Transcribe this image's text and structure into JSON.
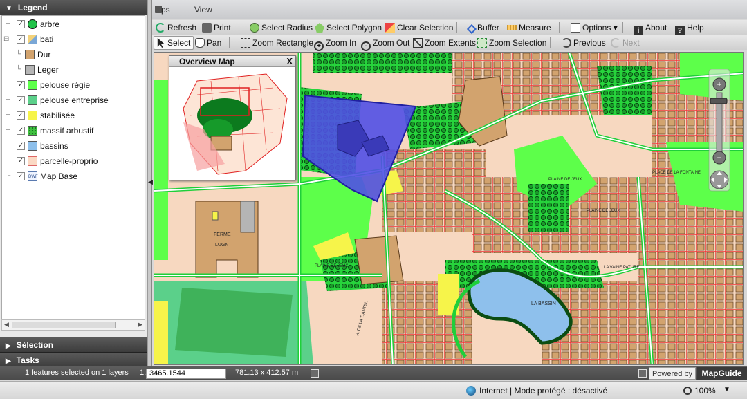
{
  "menubar": {
    "item1": "ps",
    "item2": "View"
  },
  "toolbar1": {
    "refresh": "Refresh",
    "print": "Print",
    "select_radius": "Select Radius",
    "select_polygon": "Select Polygon",
    "clear_selection": "Clear Selection",
    "buffer": "Buffer",
    "measure": "Measure",
    "options": "Options",
    "about": "About",
    "help": "Help"
  },
  "toolbar2": {
    "select": "Select",
    "pan": "Pan",
    "zoom_rectangle": "Zoom Rectangle",
    "zoom_in": "Zoom In",
    "zoom_out": "Zoom Out",
    "zoom_extents": "Zoom Extents",
    "zoom_selection": "Zoom Selection",
    "previous": "Previous",
    "next": "Next"
  },
  "legend": {
    "title": "Legend",
    "items": [
      {
        "label": "arbre",
        "color": "#22c34a",
        "shape": "circle",
        "checked": true
      },
      {
        "label": "bati",
        "color": "#7aa7d6",
        "shape": "group",
        "checked": true
      },
      {
        "label": "Dur",
        "color": "#d2a36e",
        "shape": "square",
        "sub": true
      },
      {
        "label": "Leger",
        "color": "#b5b5b5",
        "shape": "square",
        "sub": true
      },
      {
        "label": "pelouse régie",
        "color": "#5dff4a",
        "shape": "square",
        "checked": true
      },
      {
        "label": "pelouse entreprise",
        "color": "#5bd08a",
        "shape": "square",
        "checked": true
      },
      {
        "label": "stabilisée",
        "color": "#f6f44a",
        "shape": "square",
        "checked": true
      },
      {
        "label": "massif arbustif",
        "color": "#1e8f2e",
        "shape": "dots",
        "checked": true
      },
      {
        "label": "bassins",
        "color": "#8ec0ec",
        "shape": "square",
        "checked": true
      },
      {
        "label": "parcelle-proprio",
        "color": "#fbd9c4",
        "shape": "square",
        "checked": true
      },
      {
        "label": "Map Base",
        "color": "#ffffff",
        "shape": "dwf",
        "checked": true
      }
    ]
  },
  "panels": {
    "selection": "Sélection",
    "tasks": "Tasks"
  },
  "overview": {
    "title": "Overview Map",
    "close": "X"
  },
  "map_labels": {
    "ferme": "FERME",
    "lugn": "LUGN",
    "plaine_jeux_1": "PLAINE DE JEUX",
    "plaine_jeux_2": "PLAINE DE JEUX",
    "place_fontaine": "PLACE DE LA FONTAINE",
    "bassin": "LA BASSIN",
    "vaine": "LA VAINE PATURE",
    "plaine_jeux_3": "PLAINE DE JEUX",
    "rue": "R. DE LA T. AUTEL"
  },
  "status": {
    "selected": "1 features selected on 1 layers",
    "scale_prefix": "1:",
    "scale": "3465.1544",
    "extent": "781.13 x 412.57 m",
    "powered_by": "Powered by",
    "brand": "MapGuide"
  },
  "browser": {
    "zone": "Internet | Mode protégé : désactivé",
    "zoom": "100%"
  }
}
